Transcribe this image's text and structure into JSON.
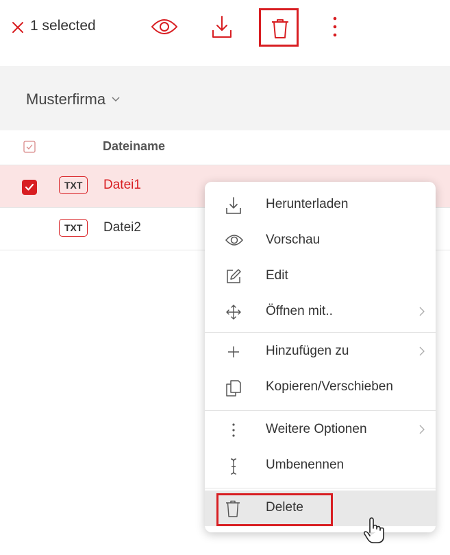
{
  "toolbar": {
    "selection_count": "1 selected",
    "icons": [
      "close-icon",
      "eye-icon",
      "download-icon",
      "trash-icon",
      "more-vertical-icon"
    ]
  },
  "breadcrumb": {
    "label": "Musterfirma"
  },
  "table": {
    "column_header": "Dateiname",
    "rows": [
      {
        "type": "TXT",
        "name": "Datei1",
        "selected": true
      },
      {
        "type": "TXT",
        "name": "Datei2",
        "selected": false
      }
    ]
  },
  "context_menu": {
    "items": [
      {
        "label": "Herunterladen",
        "icon": "download-icon"
      },
      {
        "label": "Vorschau",
        "icon": "eye-icon"
      },
      {
        "label": "Edit",
        "icon": "edit-icon"
      },
      {
        "label": "Öffnen mit..",
        "icon": "move-icon",
        "submenu": true
      },
      {
        "label": "Hinzufügen zu",
        "icon": "plus-icon",
        "submenu": true
      },
      {
        "label": "Kopieren/Verschieben",
        "icon": "copy-icon"
      },
      {
        "label": "Weitere Optionen",
        "icon": "more-vertical-icon",
        "submenu": true
      },
      {
        "label": "Umbenennen",
        "icon": "text-cursor-icon"
      },
      {
        "label": "Delete",
        "icon": "trash-icon",
        "hovered": true
      }
    ]
  },
  "colors": {
    "accent": "#d81e22",
    "selected_row": "#fbe4e4",
    "header_bg": "#f3f3f3"
  }
}
